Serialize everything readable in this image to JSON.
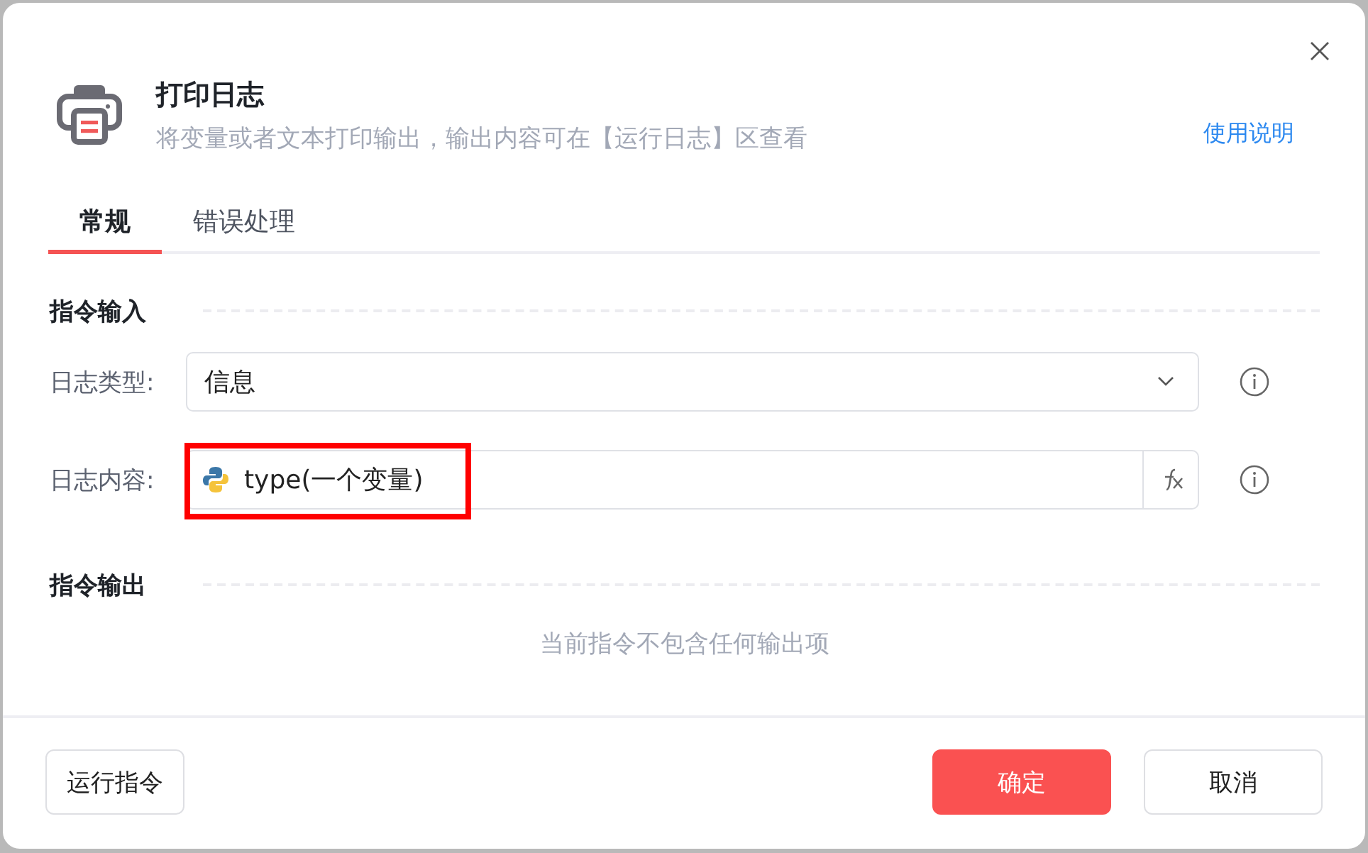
{
  "dialog": {
    "title": "打印日志",
    "description": "将变量或者文本打印输出，输出内容可在【运行日志】区查看",
    "help_link": "使用说明"
  },
  "tabs": [
    {
      "label": "常规",
      "selected": true
    },
    {
      "label": "错误处理",
      "selected": false
    }
  ],
  "sections": [
    {
      "title": "指令输入",
      "fields": [
        {
          "kind": "select",
          "label": "日志类型:",
          "value": "信息"
        },
        {
          "kind": "expression",
          "label": "日志内容:",
          "value": "type(一个变量)",
          "highlighted": true
        }
      ]
    },
    {
      "title": "指令输出",
      "empty_text": "当前指令不包含任何输出项"
    }
  ],
  "buttons": [
    {
      "label": "运行指令",
      "kind": "secondary"
    },
    {
      "label": "确定",
      "kind": "primary"
    },
    {
      "label": "取消",
      "kind": "secondary"
    }
  ]
}
